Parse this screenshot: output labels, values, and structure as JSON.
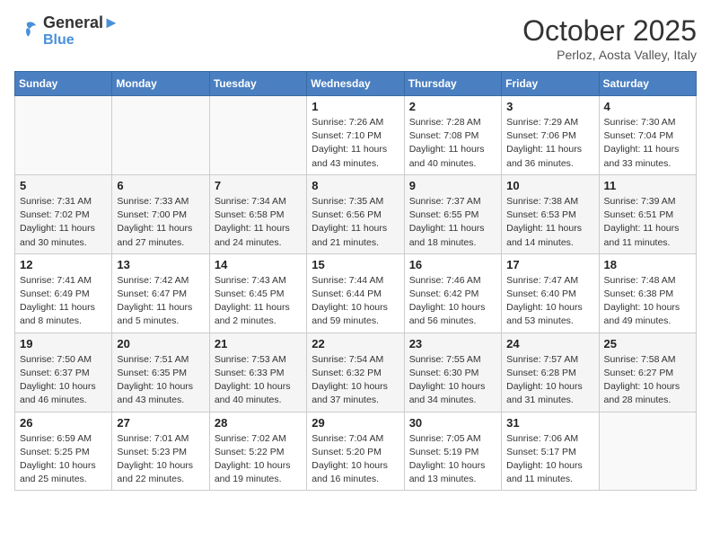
{
  "header": {
    "logo_line1": "General",
    "logo_line2": "Blue",
    "month": "October 2025",
    "location": "Perloz, Aosta Valley, Italy"
  },
  "weekdays": [
    "Sunday",
    "Monday",
    "Tuesday",
    "Wednesday",
    "Thursday",
    "Friday",
    "Saturday"
  ],
  "weeks": [
    [
      {
        "day": "",
        "info": ""
      },
      {
        "day": "",
        "info": ""
      },
      {
        "day": "",
        "info": ""
      },
      {
        "day": "1",
        "info": "Sunrise: 7:26 AM\nSunset: 7:10 PM\nDaylight: 11 hours and 43 minutes."
      },
      {
        "day": "2",
        "info": "Sunrise: 7:28 AM\nSunset: 7:08 PM\nDaylight: 11 hours and 40 minutes."
      },
      {
        "day": "3",
        "info": "Sunrise: 7:29 AM\nSunset: 7:06 PM\nDaylight: 11 hours and 36 minutes."
      },
      {
        "day": "4",
        "info": "Sunrise: 7:30 AM\nSunset: 7:04 PM\nDaylight: 11 hours and 33 minutes."
      }
    ],
    [
      {
        "day": "5",
        "info": "Sunrise: 7:31 AM\nSunset: 7:02 PM\nDaylight: 11 hours and 30 minutes."
      },
      {
        "day": "6",
        "info": "Sunrise: 7:33 AM\nSunset: 7:00 PM\nDaylight: 11 hours and 27 minutes."
      },
      {
        "day": "7",
        "info": "Sunrise: 7:34 AM\nSunset: 6:58 PM\nDaylight: 11 hours and 24 minutes."
      },
      {
        "day": "8",
        "info": "Sunrise: 7:35 AM\nSunset: 6:56 PM\nDaylight: 11 hours and 21 minutes."
      },
      {
        "day": "9",
        "info": "Sunrise: 7:37 AM\nSunset: 6:55 PM\nDaylight: 11 hours and 18 minutes."
      },
      {
        "day": "10",
        "info": "Sunrise: 7:38 AM\nSunset: 6:53 PM\nDaylight: 11 hours and 14 minutes."
      },
      {
        "day": "11",
        "info": "Sunrise: 7:39 AM\nSunset: 6:51 PM\nDaylight: 11 hours and 11 minutes."
      }
    ],
    [
      {
        "day": "12",
        "info": "Sunrise: 7:41 AM\nSunset: 6:49 PM\nDaylight: 11 hours and 8 minutes."
      },
      {
        "day": "13",
        "info": "Sunrise: 7:42 AM\nSunset: 6:47 PM\nDaylight: 11 hours and 5 minutes."
      },
      {
        "day": "14",
        "info": "Sunrise: 7:43 AM\nSunset: 6:45 PM\nDaylight: 11 hours and 2 minutes."
      },
      {
        "day": "15",
        "info": "Sunrise: 7:44 AM\nSunset: 6:44 PM\nDaylight: 10 hours and 59 minutes."
      },
      {
        "day": "16",
        "info": "Sunrise: 7:46 AM\nSunset: 6:42 PM\nDaylight: 10 hours and 56 minutes."
      },
      {
        "day": "17",
        "info": "Sunrise: 7:47 AM\nSunset: 6:40 PM\nDaylight: 10 hours and 53 minutes."
      },
      {
        "day": "18",
        "info": "Sunrise: 7:48 AM\nSunset: 6:38 PM\nDaylight: 10 hours and 49 minutes."
      }
    ],
    [
      {
        "day": "19",
        "info": "Sunrise: 7:50 AM\nSunset: 6:37 PM\nDaylight: 10 hours and 46 minutes."
      },
      {
        "day": "20",
        "info": "Sunrise: 7:51 AM\nSunset: 6:35 PM\nDaylight: 10 hours and 43 minutes."
      },
      {
        "day": "21",
        "info": "Sunrise: 7:53 AM\nSunset: 6:33 PM\nDaylight: 10 hours and 40 minutes."
      },
      {
        "day": "22",
        "info": "Sunrise: 7:54 AM\nSunset: 6:32 PM\nDaylight: 10 hours and 37 minutes."
      },
      {
        "day": "23",
        "info": "Sunrise: 7:55 AM\nSunset: 6:30 PM\nDaylight: 10 hours and 34 minutes."
      },
      {
        "day": "24",
        "info": "Sunrise: 7:57 AM\nSunset: 6:28 PM\nDaylight: 10 hours and 31 minutes."
      },
      {
        "day": "25",
        "info": "Sunrise: 7:58 AM\nSunset: 6:27 PM\nDaylight: 10 hours and 28 minutes."
      }
    ],
    [
      {
        "day": "26",
        "info": "Sunrise: 6:59 AM\nSunset: 5:25 PM\nDaylight: 10 hours and 25 minutes."
      },
      {
        "day": "27",
        "info": "Sunrise: 7:01 AM\nSunset: 5:23 PM\nDaylight: 10 hours and 22 minutes."
      },
      {
        "day": "28",
        "info": "Sunrise: 7:02 AM\nSunset: 5:22 PM\nDaylight: 10 hours and 19 minutes."
      },
      {
        "day": "29",
        "info": "Sunrise: 7:04 AM\nSunset: 5:20 PM\nDaylight: 10 hours and 16 minutes."
      },
      {
        "day": "30",
        "info": "Sunrise: 7:05 AM\nSunset: 5:19 PM\nDaylight: 10 hours and 13 minutes."
      },
      {
        "day": "31",
        "info": "Sunrise: 7:06 AM\nSunset: 5:17 PM\nDaylight: 10 hours and 11 minutes."
      },
      {
        "day": "",
        "info": ""
      }
    ]
  ]
}
